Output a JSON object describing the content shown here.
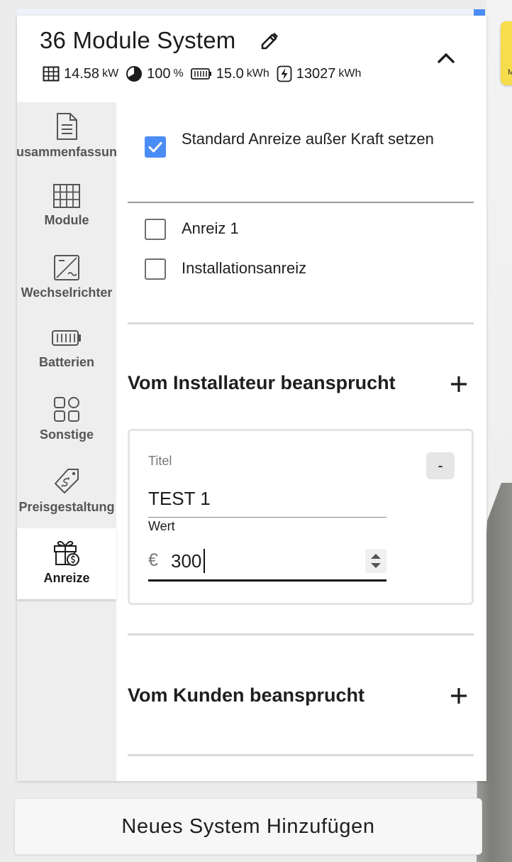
{
  "system": {
    "title": "36 Module System",
    "stats": [
      {
        "icon": "solar-panel-icon",
        "value": "14.58",
        "unit": "kW"
      },
      {
        "icon": "pie-chart-icon",
        "value": "100",
        "unit": "%"
      },
      {
        "icon": "battery-icon",
        "value": "15.0",
        "unit": "kWh"
      },
      {
        "icon": "energy-bolt-icon",
        "value": "13027",
        "unit": "kWh"
      }
    ]
  },
  "sidebar": {
    "items": [
      {
        "label": "Zusammenfassung",
        "icon": "document-icon"
      },
      {
        "label": "Module",
        "icon": "module-grid-icon"
      },
      {
        "label": "Wechselrichter",
        "icon": "inverter-icon"
      },
      {
        "label": "Batterien",
        "icon": "battery-icon"
      },
      {
        "label": "Sonstige",
        "icon": "shapes-icon"
      },
      {
        "label": "Preisgestaltung",
        "icon": "price-tag-icon"
      },
      {
        "label": "Anreize",
        "icon": "gift-icon"
      }
    ],
    "active": "Anreize"
  },
  "incentives": {
    "override_label": "Standard Anreize außer Kraft setzen",
    "override_checked": true,
    "options": [
      {
        "label": "Anreiz 1",
        "checked": false
      },
      {
        "label": "Installationsanreiz",
        "checked": false
      }
    ]
  },
  "installer_section": {
    "title": "Vom Installateur beansprucht",
    "add_label": "+",
    "card": {
      "title_label": "Titel",
      "title_value": "TEST 1",
      "remove_label": "-",
      "value_label": "Wert",
      "currency": "€",
      "value": "300"
    }
  },
  "customer_section": {
    "title": "Vom Kunden beansprucht",
    "add_label": "+"
  },
  "footer": {
    "add_system_label": "Neues System Hinzufügen"
  },
  "colors": {
    "accent": "#4b8df6",
    "panel": "#ffffff",
    "sidebar": "#eeeeee",
    "note": "#f7dd4b"
  }
}
